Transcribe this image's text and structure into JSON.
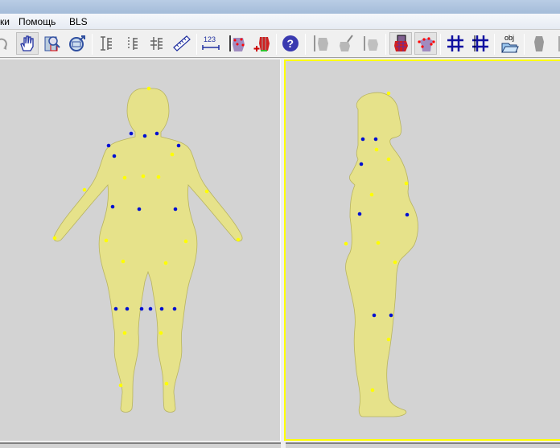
{
  "menu": {
    "items": [
      "ки",
      "Помощь",
      "BLS"
    ]
  },
  "toolbar": {
    "buttons": [
      "rotate",
      "pan",
      "zoom-window",
      "zoom-fit",
      "measure-vertical",
      "measure-vertical-dotted",
      "measure-vertical-split",
      "ruler",
      "dimension-123",
      "body-height",
      "add-mannequin",
      "help",
      "mannequin-height",
      "mannequin-edit",
      "mannequin-vertical",
      "mannequin-sections",
      "landmarks",
      "grid",
      "grid-vertical",
      "open-obj",
      "mannequin-gray"
    ],
    "dimension_label": "123",
    "obj_label": "obj"
  },
  "colors": {
    "body": "#e6e28a",
    "landmark_yellow": "#ffff00",
    "landmark_blue": "#0010d0",
    "active_border": "#ffff00",
    "viewport_bg": "#d3d3d3"
  }
}
